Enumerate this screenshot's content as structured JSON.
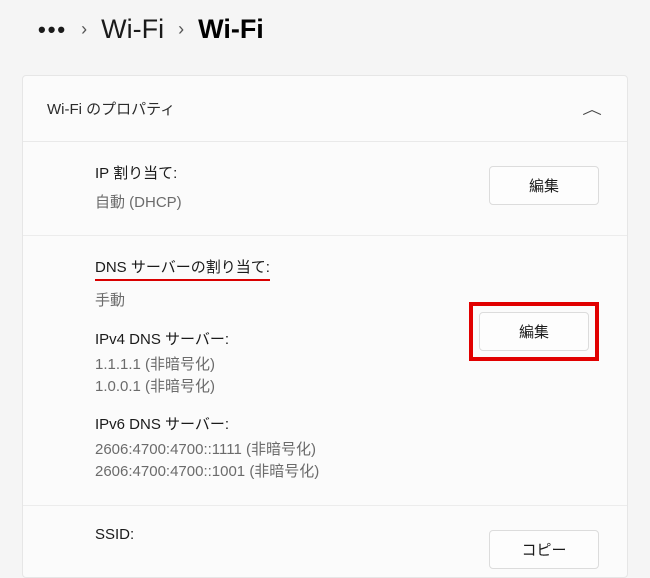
{
  "breadcrumb": {
    "more": "•••",
    "sep": "›",
    "prev": "Wi-Fi",
    "current": "Wi-Fi"
  },
  "card": {
    "title": "Wi‑Fi のプロパティ"
  },
  "buttons": {
    "edit": "編集",
    "copy": "コピー"
  },
  "ip": {
    "label": "IP 割り当て:",
    "value": "自動 (DHCP)"
  },
  "dns": {
    "label": "DNS サーバーの割り当て:",
    "mode": "手動",
    "ipv4_label": "IPv4 DNS サーバー:",
    "ipv4_line1": "1.1.1.1 (非暗号化)",
    "ipv4_line2": "1.0.0.1 (非暗号化)",
    "ipv6_label": "IPv6 DNS サーバー:",
    "ipv6_line1": "2606:4700:4700::1111 (非暗号化)",
    "ipv6_line2": "2606:4700:4700::1001 (非暗号化)"
  },
  "ssid": {
    "label": "SSID:"
  }
}
